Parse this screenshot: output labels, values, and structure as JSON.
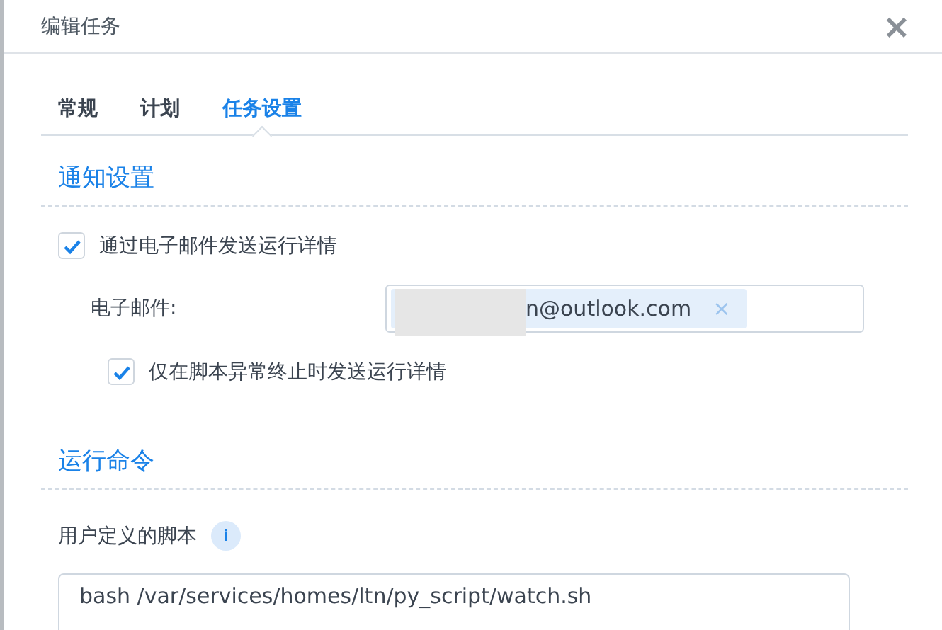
{
  "window": {
    "title": "编辑任务",
    "close": "×"
  },
  "tabs": [
    {
      "label": "常规",
      "selected": false
    },
    {
      "label": "计划",
      "selected": false
    },
    {
      "label": "任务设置",
      "selected": true
    }
  ],
  "notification": {
    "heading": "通知设置",
    "send_email": {
      "label": "通过电子邮件发送运行详情",
      "checked": true
    },
    "email": {
      "label": "电子邮件:",
      "chips": [
        {
          "value": "n@outlook.com",
          "remove": "×",
          "redacted": true
        }
      ]
    },
    "only_on_error": {
      "label": "仅在脚本异常终止时发送运行详情",
      "checked": true
    }
  },
  "command": {
    "heading": "运行命令",
    "script_label": "用户定义的脚本",
    "info": "i",
    "script": "bash /var/services/homes/ltn/py_script/watch.sh"
  }
}
